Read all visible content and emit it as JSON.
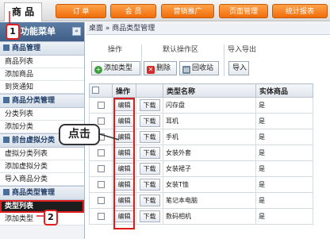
{
  "nav": {
    "active_tab": "商 品",
    "tabs": [
      "订 单",
      "会 员",
      "营销推广",
      "页面管理",
      "统计报表"
    ]
  },
  "sidebar": {
    "title": "功能菜单",
    "groups": [
      {
        "label": "商品管理",
        "items": [
          "商品列表",
          "添加商品",
          "到货通知"
        ]
      },
      {
        "label": "商品分类管理",
        "items": [
          "分类列表",
          "添加分类"
        ]
      },
      {
        "label": "前台虚拟分类",
        "items": [
          "虚拟分类列表",
          "添加虚拟分类",
          "导入商品分类"
        ]
      },
      {
        "label": "商品类型管理",
        "items": [
          "类型列表",
          "添加类型"
        ]
      }
    ],
    "selected_item": "类型列表"
  },
  "breadcrumb": "桌面 » 商品类型管理",
  "toolbar": {
    "operate_label": "操作",
    "default_area_label": "默认操作区",
    "import_export_label": "导入导出",
    "add_type": "添加类型",
    "delete": "删除",
    "recycle": "回收站",
    "import": "导入"
  },
  "table": {
    "headers": [
      "",
      "操作",
      "",
      "类型名称",
      "实体商品"
    ],
    "edit_label": "编辑",
    "download_label": "下载",
    "rows": [
      {
        "name": "闪存盘",
        "physical": "是"
      },
      {
        "name": "耳机",
        "physical": "是"
      },
      {
        "name": "手机",
        "physical": "是"
      },
      {
        "name": "女装外套",
        "physical": "是"
      },
      {
        "name": "女装裙子",
        "physical": "是"
      },
      {
        "name": "女装T恤",
        "physical": "是"
      },
      {
        "name": "笔记本电脑",
        "physical": "是"
      },
      {
        "name": "数码相机",
        "physical": "是"
      }
    ]
  },
  "annotations": {
    "callout_text": "点击",
    "step1": "1",
    "step2": "2"
  },
  "colors": {
    "accent_orange": "#f07a12",
    "annotation_red": "#e02020",
    "sidebar_header": "#4a6e9a"
  }
}
